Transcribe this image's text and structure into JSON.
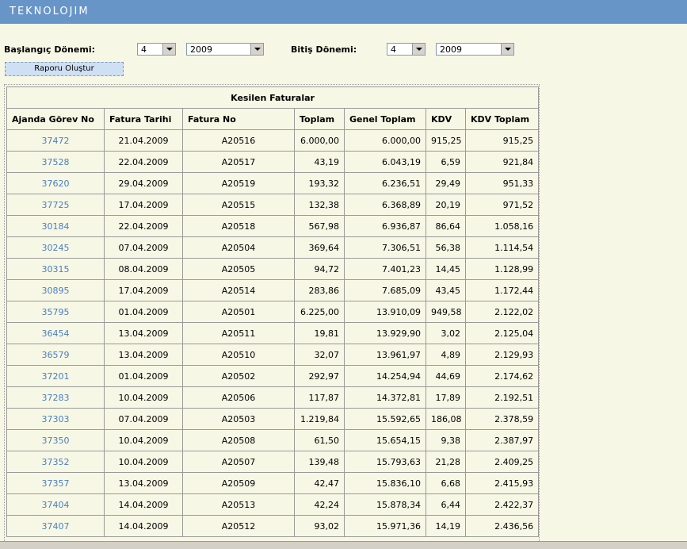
{
  "header": {
    "brand": "TEKNOLOJIM"
  },
  "filters": {
    "start_label": "Başlangıç Dönemi:",
    "start_month": "4",
    "start_year": "2009",
    "end_label": "Bitiş Dönemi:",
    "end_month": "4",
    "end_year": "2009",
    "report_button": "Raporu Oluştur"
  },
  "table": {
    "caption": "Kesilen Faturalar",
    "columns": [
      "Ajanda Görev No",
      "Fatura Tarihi",
      "Fatura No",
      "Toplam",
      "Genel Toplam",
      "KDV",
      "KDV Toplam"
    ],
    "rows": [
      [
        "37472",
        "21.04.2009",
        "A20516",
        "6.000,00",
        "6.000,00",
        "915,25",
        "915,25"
      ],
      [
        "37528",
        "22.04.2009",
        "A20517",
        "43,19",
        "6.043,19",
        "6,59",
        "921,84"
      ],
      [
        "37620",
        "29.04.2009",
        "A20519",
        "193,32",
        "6.236,51",
        "29,49",
        "951,33"
      ],
      [
        "37725",
        "17.04.2009",
        "A20515",
        "132,38",
        "6.368,89",
        "20,19",
        "971,52"
      ],
      [
        "30184",
        "22.04.2009",
        "A20518",
        "567,98",
        "6.936,87",
        "86,64",
        "1.058,16"
      ],
      [
        "30245",
        "07.04.2009",
        "A20504",
        "369,64",
        "7.306,51",
        "56,38",
        "1.114,54"
      ],
      [
        "30315",
        "08.04.2009",
        "A20505",
        "94,72",
        "7.401,23",
        "14,45",
        "1.128,99"
      ],
      [
        "30895",
        "17.04.2009",
        "A20514",
        "283,86",
        "7.685,09",
        "43,45",
        "1.172,44"
      ],
      [
        "35795",
        "01.04.2009",
        "A20501",
        "6.225,00",
        "13.910,09",
        "949,58",
        "2.122,02"
      ],
      [
        "36454",
        "13.04.2009",
        "A20511",
        "19,81",
        "13.929,90",
        "3,02",
        "2.125,04"
      ],
      [
        "36579",
        "13.04.2009",
        "A20510",
        "32,07",
        "13.961,97",
        "4,89",
        "2.129,93"
      ],
      [
        "37201",
        "01.04.2009",
        "A20502",
        "292,97",
        "14.254,94",
        "44,69",
        "2.174,62"
      ],
      [
        "37283",
        "10.04.2009",
        "A20506",
        "117,87",
        "14.372,81",
        "17,89",
        "2.192,51"
      ],
      [
        "37303",
        "07.04.2009",
        "A20503",
        "1.219,84",
        "15.592,65",
        "186,08",
        "2.378,59"
      ],
      [
        "37350",
        "10.04.2009",
        "A20508",
        "61,50",
        "15.654,15",
        "9,38",
        "2.387,97"
      ],
      [
        "37352",
        "10.04.2009",
        "A20507",
        "139,48",
        "15.793,63",
        "21,28",
        "2.409,25"
      ],
      [
        "37357",
        "13.04.2009",
        "A20509",
        "42,47",
        "15.836,10",
        "6,68",
        "2.415,93"
      ],
      [
        "37404",
        "14.04.2009",
        "A20513",
        "42,24",
        "15.878,34",
        "6,44",
        "2.422,37"
      ],
      [
        "37407",
        "14.04.2009",
        "A20512",
        "93,02",
        "15.971,36",
        "14,19",
        "2.436,56"
      ]
    ]
  }
}
